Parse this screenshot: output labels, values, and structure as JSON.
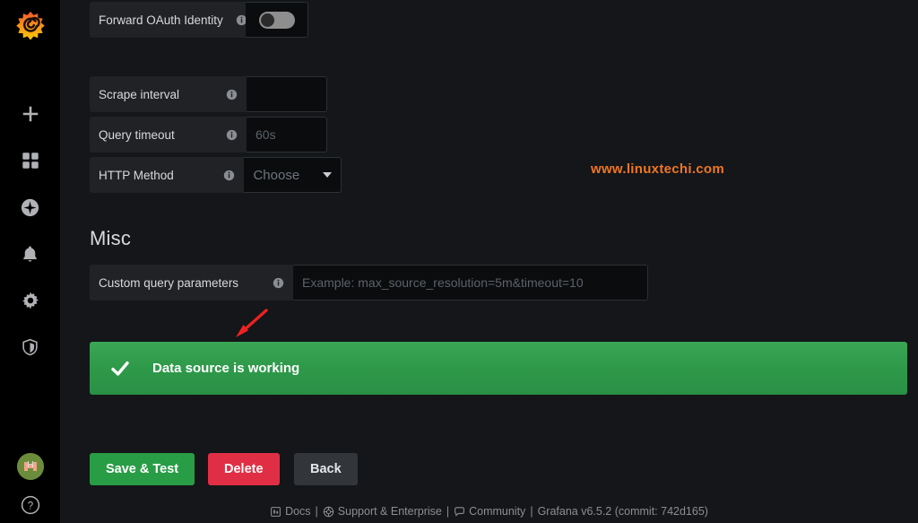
{
  "sidebar": {
    "logo": "grafana-logo",
    "items": [
      {
        "name": "create-add",
        "icon": "plus-icon"
      },
      {
        "name": "dashboards",
        "icon": "dashboards-grid-icon"
      },
      {
        "name": "explore",
        "icon": "compass-icon"
      },
      {
        "name": "alerting",
        "icon": "bell-icon"
      },
      {
        "name": "configuration",
        "icon": "gear-icon"
      },
      {
        "name": "server-admin",
        "icon": "shield-icon"
      }
    ],
    "bottom": [
      {
        "name": "user-profile",
        "icon": "avatar-icon"
      },
      {
        "name": "help",
        "icon": "question-circle-icon"
      }
    ]
  },
  "form": {
    "forward_oauth": {
      "label": "Forward OAuth Identity",
      "info_icon": "info-icon",
      "toggle_state": "off"
    },
    "scrape_interval": {
      "label": "Scrape interval",
      "info_icon": "info-icon",
      "value": "",
      "placeholder": ""
    },
    "query_timeout": {
      "label": "Query timeout",
      "info_icon": "info-icon",
      "value": "",
      "placeholder": "60s"
    },
    "http_method": {
      "label": "HTTP Method",
      "info_icon": "info-icon",
      "selected": "Choose",
      "caret_icon": "chevron-down-icon"
    }
  },
  "misc": {
    "heading": "Misc",
    "custom_query_parameters": {
      "label": "Custom query parameters",
      "info_icon": "info-icon",
      "value": "",
      "placeholder": "Example: max_source_resolution=5m&timeout=10"
    }
  },
  "alert": {
    "icon": "check-icon",
    "message": "Data source is working",
    "color": "#2f9a4a"
  },
  "annotation": {
    "arrow_icon": "red-arrow-icon",
    "color": "#ee2222"
  },
  "watermark": {
    "text": "www.linuxtechi.com",
    "color": "#ef7622"
  },
  "buttons": {
    "save": "Save & Test",
    "delete": "Delete",
    "back": "Back"
  },
  "footer": {
    "docs": "Docs",
    "docs_icon": "book-icon",
    "support": "Support & Enterprise",
    "support_icon": "lifebuoy-icon",
    "community": "Community",
    "community_icon": "comment-icon",
    "version": "Grafana v6.5.2 (commit: 742d165)",
    "sep1": "|",
    "sep2": "|",
    "sep3": "|"
  }
}
